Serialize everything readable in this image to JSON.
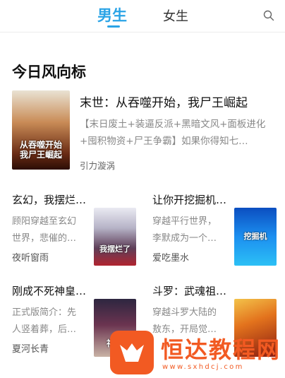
{
  "tabs": {
    "male": "男生",
    "female": "女生"
  },
  "icons": {
    "search": "search-icon"
  },
  "section_title": "今日风向标",
  "feature": {
    "title": "末世：从吞噬开始，我尸王崛起",
    "desc": "【末日废土+装逼反派+黑暗文风+面板进化+囤积物资+尸王争霸】如果你得知七…",
    "author": "引力漩涡",
    "cover_text": "从吞噬开始 我尸王崛起"
  },
  "cards": [
    {
      "title": "玄幻，我摆烂…",
      "desc": "顾阳穿越至玄幻世界，悲催的…",
      "author": "夜听窗雨",
      "cover_text": "我摆烂了"
    },
    {
      "title": "让你开挖掘机…",
      "desc": "穿越平行世界，李默成为一个…",
      "author": "爱吃墨水",
      "cover_text": "挖掘机"
    },
    {
      "title": "刚成不死神皇…",
      "desc": "正式版简介：先人竖着葬，后…",
      "author": "夏河长青",
      "cover_text": "神皇"
    },
    {
      "title": "斗罗：武魂祖…",
      "desc": "穿越斗罗大陆的敖东，开局觉…",
      "author": "",
      "cover_text": ""
    }
  ],
  "watermark": {
    "text": "恒达教程网",
    "url": "www.sxhdcj.com"
  }
}
